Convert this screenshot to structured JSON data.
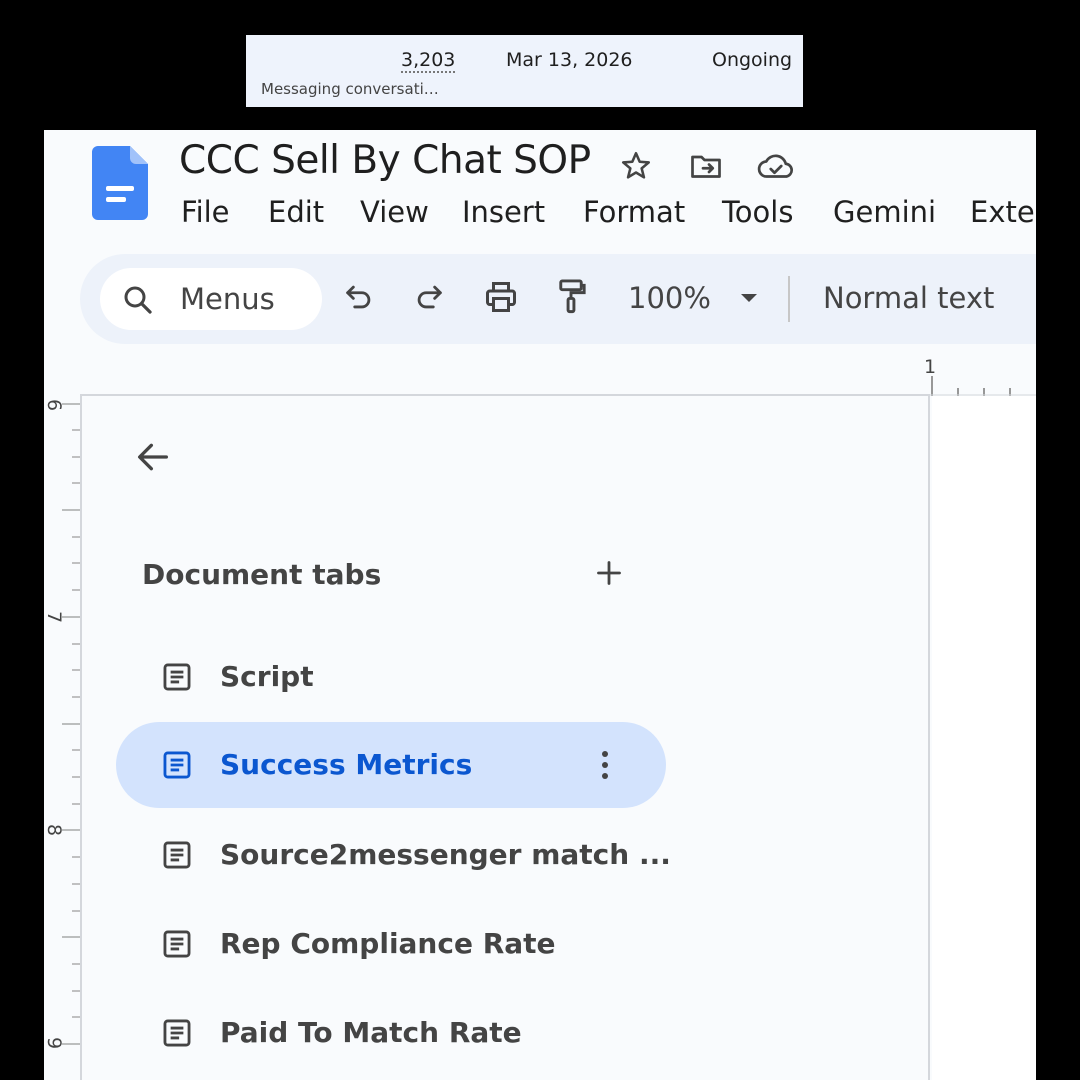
{
  "snippet": {
    "count": "3,203",
    "date": "Mar 13, 2026",
    "status": "Ongoing",
    "subtitle": "Messaging conversati…"
  },
  "doc": {
    "title": "CCC Sell By Chat SOP",
    "menus": [
      "File",
      "Edit",
      "View",
      "Insert",
      "Format",
      "Tools",
      "Gemini",
      "Exter"
    ]
  },
  "toolbar": {
    "search_label": "Menus",
    "zoom": "100%",
    "style": "Normal text"
  },
  "ruler": {
    "h_label": "1",
    "v_labels": [
      "6",
      "7",
      "8",
      "9"
    ]
  },
  "panel": {
    "heading": "Document tabs",
    "tabs": [
      {
        "label": "Script",
        "active": false
      },
      {
        "label": "Success Metrics",
        "active": true
      },
      {
        "label": "Source2messenger match ...",
        "active": false
      },
      {
        "label": "Rep Compliance Rate",
        "active": false
      },
      {
        "label": "Paid To Match Rate",
        "active": false
      }
    ]
  },
  "colors": {
    "accent": "#0b57d0",
    "active_tab_bg": "#d3e3fd",
    "toolbar_bg": "#edf2fa",
    "docs_blue": "#4285f4"
  },
  "icons": [
    "docs-logo-icon",
    "star-icon",
    "move-to-folder-icon",
    "cloud-saved-icon",
    "search-icon",
    "undo-icon",
    "redo-icon",
    "print-icon",
    "paint-format-icon",
    "chevron-down-icon",
    "back-arrow-icon",
    "plus-icon",
    "document-tab-icon",
    "more-vertical-icon"
  ]
}
